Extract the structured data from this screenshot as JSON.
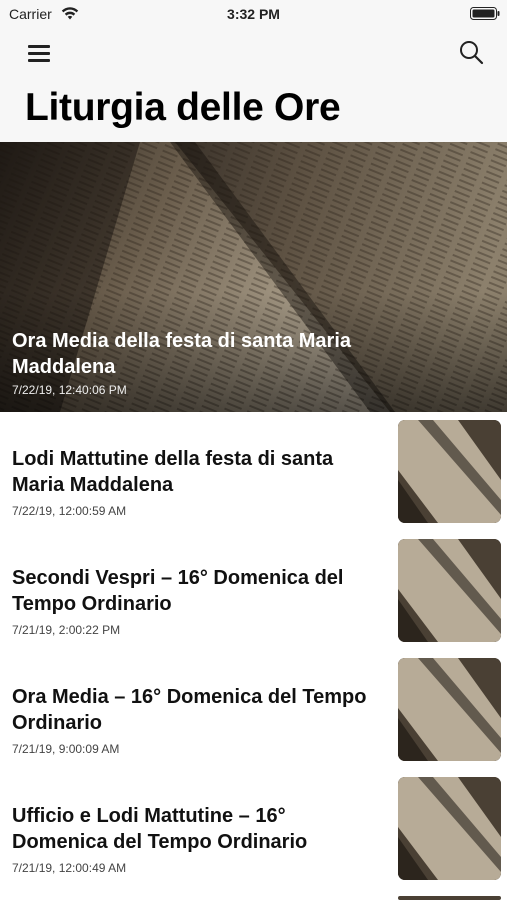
{
  "status_bar": {
    "carrier": "Carrier",
    "time": "3:32 PM"
  },
  "nav": {
    "title": "Liturgia delle Ore",
    "menu_icon": "hamburger-menu-icon",
    "search_icon": "search-icon"
  },
  "featured": {
    "title": "Ora Media della festa di santa Maria Maddalena",
    "date": "7/22/19, 12:40:06 PM"
  },
  "items": [
    {
      "title": "Lodi Mattutine della festa di santa Maria Maddalena",
      "date": "7/22/19, 12:00:59 AM"
    },
    {
      "title": "Secondi Vespri – 16° Domenica del Tempo Ordinario",
      "date": "7/21/19, 2:00:22 PM"
    },
    {
      "title": "Ora Media – 16° Domenica del Tempo Ordinario",
      "date": "7/21/19, 9:00:09 AM"
    },
    {
      "title": "Ufficio e Lodi Mattutine – 16° Domenica del Tempo Ordinario",
      "date": "7/21/19, 12:00:49 AM"
    }
  ]
}
